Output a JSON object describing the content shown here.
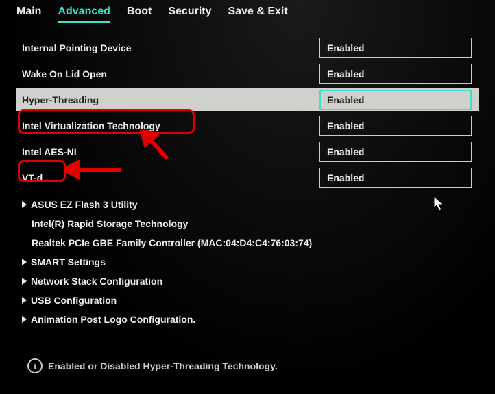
{
  "tabs": {
    "main": "Main",
    "advanced": "Advanced",
    "boot": "Boot",
    "security": "Security",
    "save_exit": "Save & Exit",
    "active": "advanced"
  },
  "settings": {
    "internal_pointing": {
      "label": "Internal Pointing Device",
      "value": "Enabled"
    },
    "wake_on_lid": {
      "label": "Wake On Lid Open",
      "value": "Enabled"
    },
    "hyper_threading": {
      "label": "Hyper-Threading",
      "value": "Enabled"
    },
    "intel_vt": {
      "label": "Intel Virtualization Technology",
      "value": "Enabled"
    },
    "aes_ni": {
      "label": "Intel AES-NI",
      "value": "Enabled"
    },
    "vt_d": {
      "label": "VT-d",
      "value": "Enabled"
    }
  },
  "submenus": {
    "ez_flash": "ASUS EZ Flash 3 Utility",
    "rst": "Intel(R) Rapid Storage Technology",
    "realtek": "Realtek PCIe GBE Family Controller (MAC:04:D4:C4:76:03:74)",
    "smart": "SMART Settings",
    "net_stack": "Network Stack Configuration",
    "usb": "USB Configuration",
    "anim_logo": "Animation Post Logo Configuration."
  },
  "help_text": "Enabled or Disabled Hyper-Threading Technology."
}
